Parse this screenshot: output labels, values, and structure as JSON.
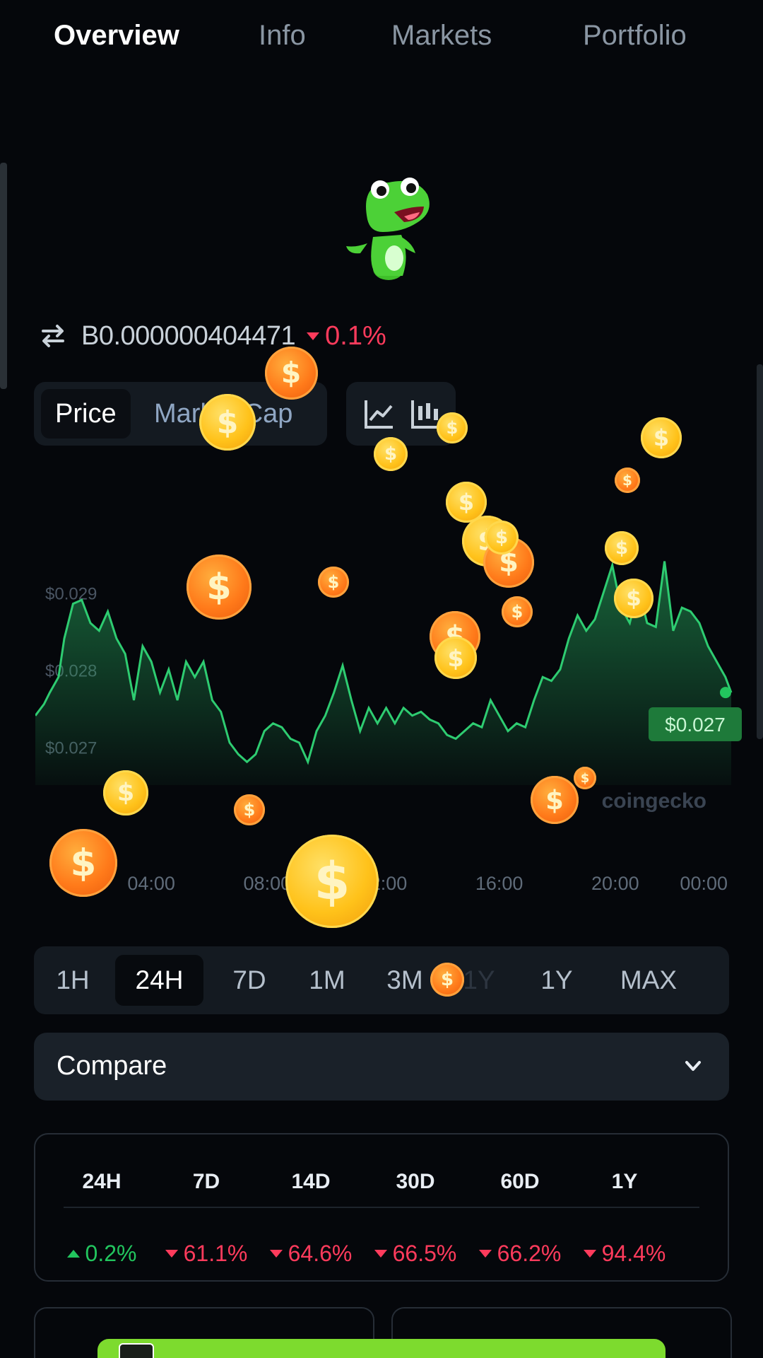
{
  "tabs": [
    {
      "label": "Overview",
      "active": true
    },
    {
      "label": "Info",
      "active": false
    },
    {
      "label": "Markets",
      "active": false
    },
    {
      "label": "Portfolio",
      "active": false
    }
  ],
  "price": {
    "value": "B0.000000404471",
    "change": "0.1%",
    "change_direction": "down"
  },
  "chart_toggle": {
    "price_label": "Price",
    "market_cap_label": "Market Cap",
    "selected": "Price"
  },
  "chart_data": {
    "type": "area",
    "x_ticks": [
      "04:00",
      "08:00",
      "12:00",
      "16:00",
      "20:00",
      "00:00"
    ],
    "y_ticks": [
      "$0.029",
      "$0.028",
      "$0.027"
    ],
    "ylim": [
      0.0265,
      0.0298
    ],
    "current_price_label": "$0.027",
    "watermark": "coingecko",
    "points": [
      [
        0,
        0.0274
      ],
      [
        0.3,
        0.02755
      ],
      [
        0.5,
        0.0277
      ],
      [
        0.8,
        0.0279
      ],
      [
        1.0,
        0.0284
      ],
      [
        1.3,
        0.02885
      ],
      [
        1.6,
        0.0289
      ],
      [
        1.9,
        0.0286
      ],
      [
        2.2,
        0.0285
      ],
      [
        2.5,
        0.02875
      ],
      [
        2.8,
        0.0284
      ],
      [
        3.1,
        0.0282
      ],
      [
        3.4,
        0.0276
      ],
      [
        3.7,
        0.0283
      ],
      [
        4.0,
        0.0281
      ],
      [
        4.3,
        0.0277
      ],
      [
        4.6,
        0.028
      ],
      [
        4.9,
        0.0276
      ],
      [
        5.2,
        0.0281
      ],
      [
        5.5,
        0.0279
      ],
      [
        5.8,
        0.0281
      ],
      [
        6.1,
        0.0276
      ],
      [
        6.4,
        0.02745
      ],
      [
        6.7,
        0.02705
      ],
      [
        7.0,
        0.0269
      ],
      [
        7.3,
        0.0268
      ],
      [
        7.6,
        0.0269
      ],
      [
        7.9,
        0.0272
      ],
      [
        8.2,
        0.0273
      ],
      [
        8.5,
        0.02725
      ],
      [
        8.8,
        0.0271
      ],
      [
        9.1,
        0.02705
      ],
      [
        9.4,
        0.0268
      ],
      [
        9.7,
        0.0272
      ],
      [
        10.0,
        0.0274
      ],
      [
        10.3,
        0.0277
      ],
      [
        10.6,
        0.02805
      ],
      [
        10.9,
        0.0276
      ],
      [
        11.2,
        0.0272
      ],
      [
        11.5,
        0.0275
      ],
      [
        11.8,
        0.0273
      ],
      [
        12.1,
        0.0275
      ],
      [
        12.4,
        0.0273
      ],
      [
        12.7,
        0.0275
      ],
      [
        13.0,
        0.0274
      ],
      [
        13.3,
        0.02745
      ],
      [
        13.6,
        0.02735
      ],
      [
        13.9,
        0.0273
      ],
      [
        14.2,
        0.02715
      ],
      [
        14.5,
        0.0271
      ],
      [
        14.8,
        0.0272
      ],
      [
        15.1,
        0.0273
      ],
      [
        15.4,
        0.02725
      ],
      [
        15.7,
        0.0276
      ],
      [
        16.0,
        0.0274
      ],
      [
        16.3,
        0.0272
      ],
      [
        16.6,
        0.0273
      ],
      [
        16.9,
        0.02725
      ],
      [
        17.2,
        0.0276
      ],
      [
        17.5,
        0.0279
      ],
      [
        17.8,
        0.02785
      ],
      [
        18.1,
        0.028
      ],
      [
        18.4,
        0.0284
      ],
      [
        18.7,
        0.0287
      ],
      [
        19.0,
        0.0285
      ],
      [
        19.3,
        0.02865
      ],
      [
        19.6,
        0.029
      ],
      [
        19.9,
        0.02935
      ],
      [
        20.2,
        0.0288
      ],
      [
        20.5,
        0.0286
      ],
      [
        20.8,
        0.02905
      ],
      [
        21.1,
        0.0286
      ],
      [
        21.4,
        0.02855
      ],
      [
        21.7,
        0.0294
      ],
      [
        22.0,
        0.0285
      ],
      [
        22.3,
        0.0288
      ],
      [
        22.6,
        0.02875
      ],
      [
        22.9,
        0.0286
      ],
      [
        23.2,
        0.0283
      ],
      [
        23.5,
        0.0281
      ],
      [
        23.8,
        0.0279
      ],
      [
        24.0,
        0.0277
      ]
    ]
  },
  "ranges": [
    {
      "label": "1H",
      "active": false
    },
    {
      "label": "24H",
      "active": true
    },
    {
      "label": "7D",
      "active": false
    },
    {
      "label": "1M",
      "active": false
    },
    {
      "label": "3M",
      "active": false
    },
    {
      "label": "1Y",
      "active": false
    },
    {
      "label": "1Y",
      "active": false
    },
    {
      "label": "MAX",
      "active": false
    }
  ],
  "compare": {
    "label": "Compare"
  },
  "performance": [
    {
      "period": "24H",
      "change": "0.2%",
      "direction": "up"
    },
    {
      "period": "7D",
      "change": "61.1%",
      "direction": "down"
    },
    {
      "period": "14D",
      "change": "64.6%",
      "direction": "down"
    },
    {
      "period": "30D",
      "change": "66.5%",
      "direction": "down"
    },
    {
      "period": "60D",
      "change": "66.2%",
      "direction": "down"
    },
    {
      "period": "1Y",
      "change": "94.4%",
      "direction": "down"
    }
  ],
  "coin_symbol": "$",
  "icons": [
    "swap-icon",
    "line-chart-icon",
    "candlestick-icon",
    "chevron-down-icon",
    "gecko-mascot"
  ],
  "colors": {
    "background": "#05070b",
    "positive": "#22c55e",
    "negative": "#ff3b5c",
    "chart_line": "#27ae60",
    "price_tag": "#1e7a3a",
    "ad_banner": "#7ddb2e"
  }
}
